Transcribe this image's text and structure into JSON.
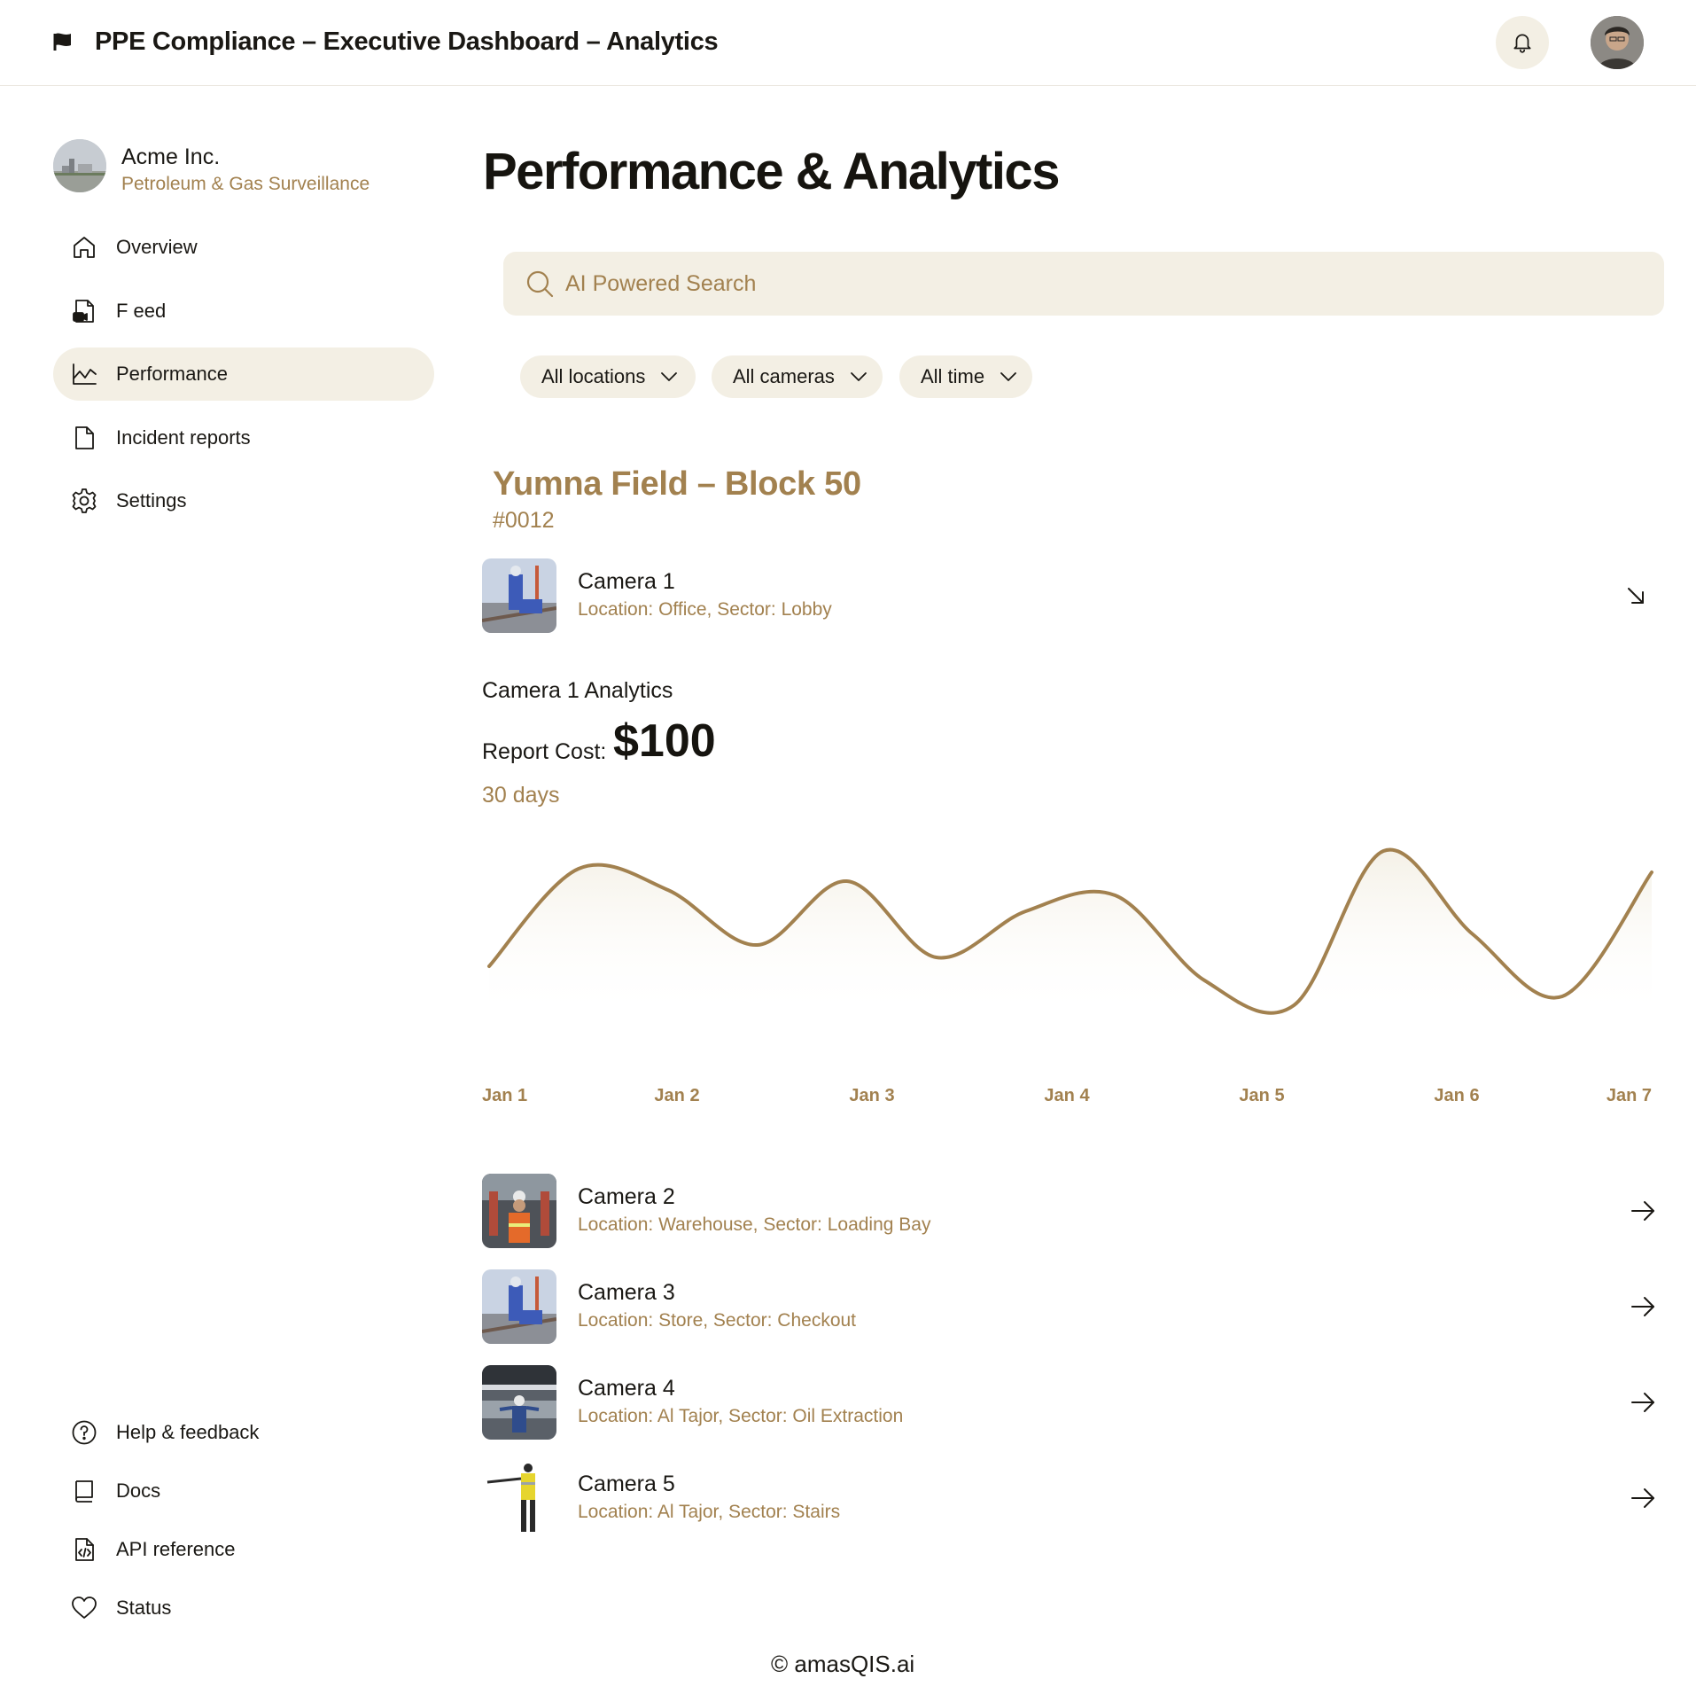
{
  "header": {
    "title": "PPE Compliance – Executive Dashboard –  Analytics",
    "icons": [
      "flag-icon",
      "bell-icon",
      "user-avatar"
    ]
  },
  "sidebar": {
    "org_name": "Acme Inc.",
    "org_subtitle": "Petroleum & Gas Surveillance",
    "nav": [
      {
        "label": "Overview",
        "icon": "home-icon",
        "active": false
      },
      {
        "label": "F eed",
        "icon": "video-file-icon",
        "active": false
      },
      {
        "label": "Performance",
        "icon": "line-chart-icon",
        "active": true
      },
      {
        "label": "Incident reports",
        "icon": "document-icon",
        "active": false
      },
      {
        "label": "Settings",
        "icon": "gear-icon",
        "active": false
      }
    ],
    "footer_nav": [
      {
        "label": "Help & feedback",
        "icon": "help-circle-icon"
      },
      {
        "label": "Docs",
        "icon": "book-icon"
      },
      {
        "label": "API reference",
        "icon": "code-file-icon"
      },
      {
        "label": "Status",
        "icon": "heart-icon"
      }
    ]
  },
  "main": {
    "title": "Performance & Analytics",
    "search": {
      "placeholder": "AI Powered Search",
      "value": ""
    },
    "filters": [
      {
        "label": "All locations"
      },
      {
        "label": "All cameras"
      },
      {
        "label": "All time"
      }
    ],
    "site": {
      "name": "Yumna Field –  Block 50",
      "id": "#0012"
    },
    "selected_camera": {
      "name": "Camera 1",
      "location": "Location: Office, Sector: Lobby",
      "expanded": true
    },
    "analytics": {
      "title": "Camera 1 Analytics",
      "report_label": "Report Cost:",
      "report_value": "$100",
      "period": "30 days"
    },
    "cameras": [
      {
        "name": "Camera 2",
        "location": "Location: Warehouse, Sector: Loading Bay"
      },
      {
        "name": "Camera 3",
        "location": "Location: Store, Sector: Checkout"
      },
      {
        "name": "Camera 4",
        "location": "Location: Al Tajor, Sector: Oil Extraction"
      },
      {
        "name": "Camera 5",
        "location": "Location: Al Tajor, Sector: Stairs"
      }
    ]
  },
  "chart_data": {
    "type": "line",
    "x": [
      0,
      0.5,
      1,
      1.5,
      2,
      2.5,
      3,
      3.5,
      4,
      4.5,
      5,
      5.5,
      6,
      6.5,
      7
    ],
    "categories": [
      "Jan 1",
      "Jan 2",
      "Jan 3",
      "Jan 4",
      "Jan 5",
      "Jan 6",
      "Jan 7"
    ],
    "series": [
      {
        "values": [
          30,
          85,
          73,
          42,
          78,
          35,
          61,
          70,
          22,
          8,
          95,
          48,
          13,
          83
        ]
      }
    ],
    "x_plot": [
      0,
      0.5,
      1,
      1.5,
      2,
      2.5,
      3,
      3.5,
      4,
      4.5,
      5,
      5.5,
      6,
      6.5
    ],
    "ylim": [
      0,
      100
    ],
    "grid": false,
    "line_color": "#a2814f"
  },
  "copyright": "© amasQIS.ai",
  "colors": {
    "accent": "#a2814f",
    "surface": "#f3efe4",
    "text": "#1a1814"
  }
}
